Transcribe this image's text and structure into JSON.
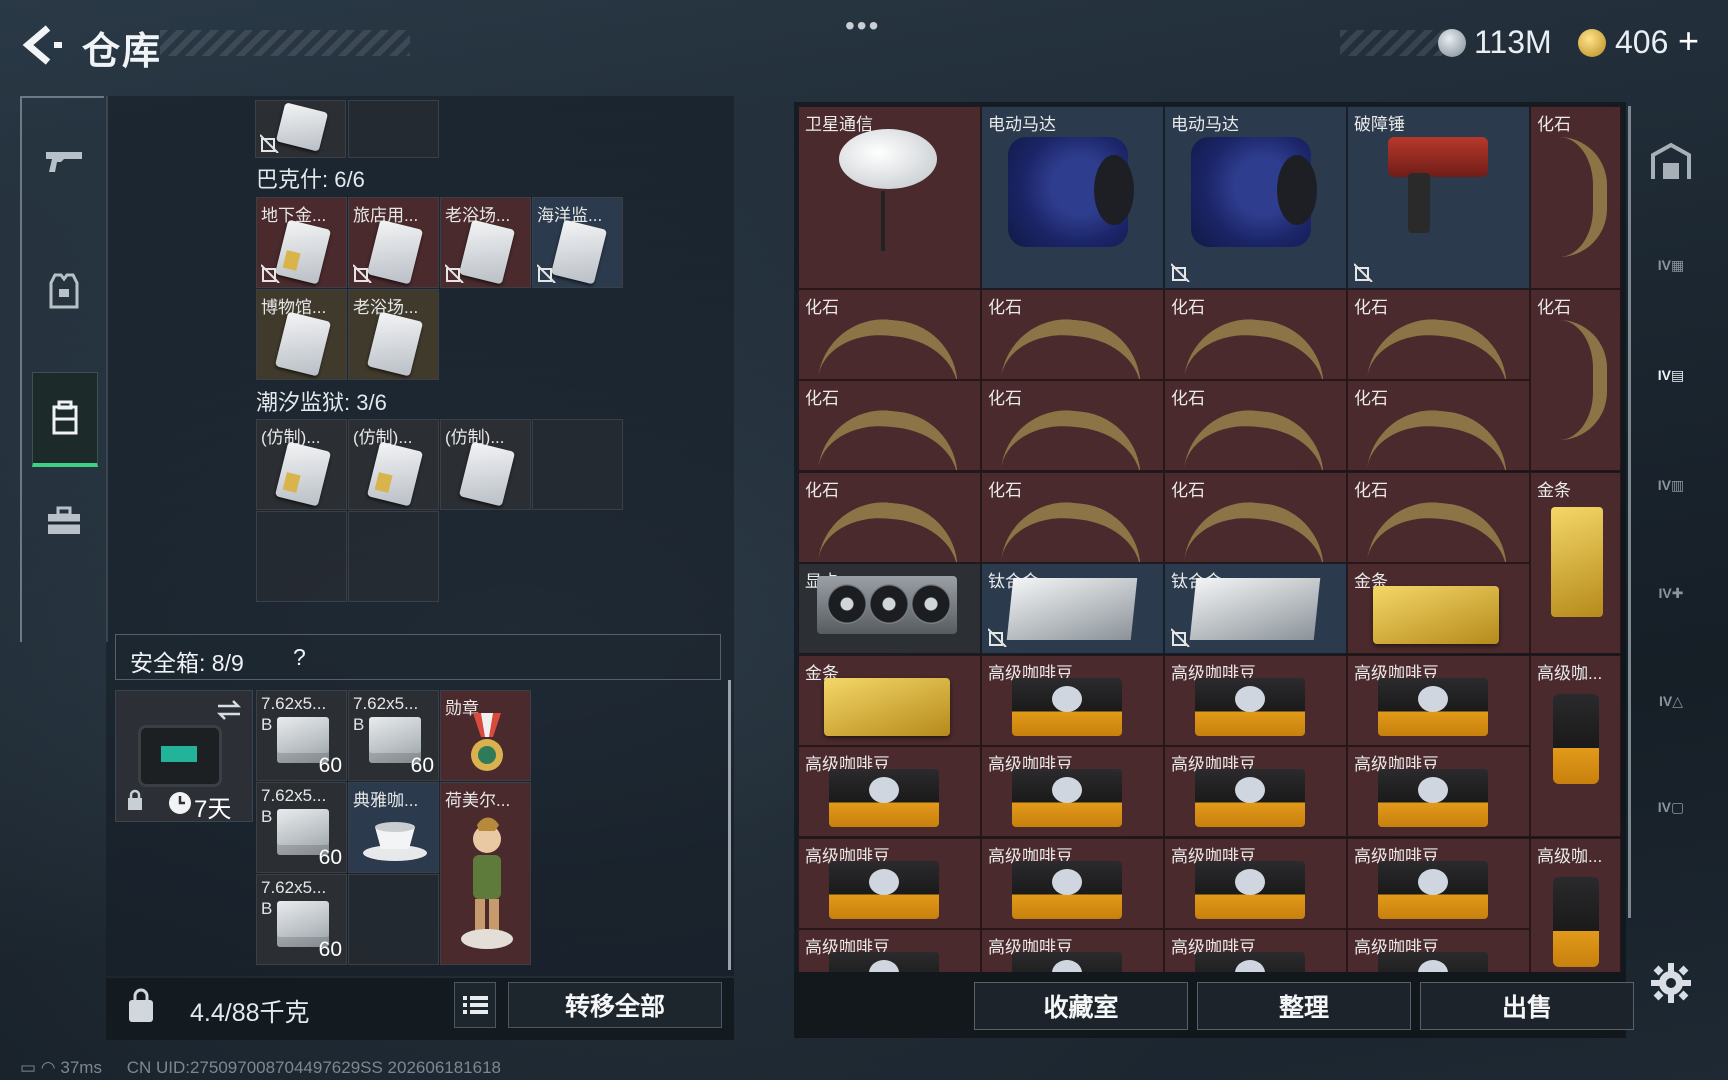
{
  "header": {
    "title": "仓库",
    "money": "113M",
    "bonds": "406",
    "more_icon": "more-dots-icon",
    "add_label": "+"
  },
  "left_nav": [
    "weapon-tab-icon",
    "armor-tab-icon",
    "backpack-tab-icon",
    "case-tab-icon"
  ],
  "left_panel": {
    "sections": [
      {
        "label": "巴克什: 6/6"
      },
      {
        "label": "潮汐监狱: 3/6"
      }
    ],
    "top_card_slot": {
      "label": ""
    },
    "bakshi_items": [
      "地下金...",
      "旅店用...",
      "老浴场...",
      "海洋监...",
      "博物馆...",
      "老浴场..."
    ],
    "prison_items": [
      "(仿制)...",
      "(仿制)...",
      "(仿制)..."
    ],
    "safe_box": {
      "label": "安全箱: 8/9",
      "help": "?",
      "duration": "7天",
      "items": [
        {
          "name": "7.62x5...",
          "sub": "B",
          "count": "60"
        },
        {
          "name": "7.62x5...",
          "sub": "B",
          "count": "60"
        },
        {
          "name": "勋章",
          "sub": "",
          "count": ""
        },
        {
          "name": "7.62x5...",
          "sub": "B",
          "count": "60"
        },
        {
          "name": "典雅咖...",
          "sub": "",
          "count": ""
        },
        {
          "name": "荷美尔...",
          "sub": "",
          "count": ""
        },
        {
          "name": "7.62x5...",
          "sub": "B",
          "count": "60"
        }
      ]
    },
    "weight": "4.4/88千克",
    "transfer_all": "转移全部"
  },
  "status_bar": {
    "ping": "37ms",
    "uid": "CN UID:275097008704497629SS 202606181618"
  },
  "right_grid": {
    "rows": [
      [
        "卫星通信",
        "电动马达",
        "电动马达",
        "破障锤",
        "化石"
      ],
      [
        "化石",
        "化石",
        "化石",
        "化石",
        "化石"
      ],
      [
        "化石",
        "化石",
        "化石",
        "化石",
        ""
      ],
      [
        "化石",
        "化石",
        "化石",
        "化石",
        "金条"
      ],
      [
        "显卡",
        "钛合金",
        "钛合金",
        "金条",
        ""
      ],
      [
        "金条",
        "高级咖啡豆",
        "高级咖啡豆",
        "高级咖啡豆",
        "高级咖..."
      ],
      [
        "高级咖啡豆",
        "高级咖啡豆",
        "高级咖啡豆",
        "高级咖啡豆",
        ""
      ],
      [
        "高级咖啡豆",
        "高级咖啡豆",
        "高级咖啡豆",
        "高级咖啡豆",
        "高级咖..."
      ],
      [
        "高级咖啡豆",
        "高级咖啡豆",
        "高级咖啡豆",
        "高级咖啡豆",
        ""
      ]
    ],
    "buttons": {
      "collection": "收藏室",
      "sort": "整理",
      "sell": "出售"
    }
  },
  "right_side_tabs": [
    "IV",
    "IV",
    "IV",
    "IV",
    "IV",
    "IV"
  ]
}
